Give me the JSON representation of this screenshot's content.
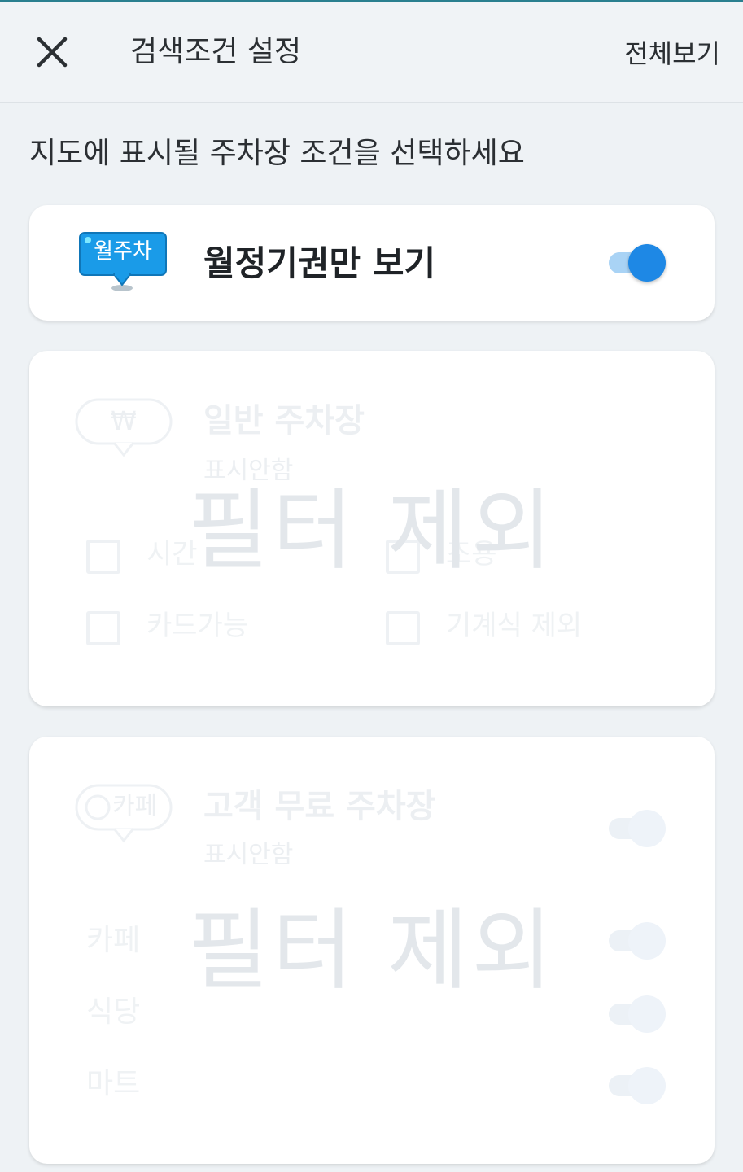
{
  "header": {
    "title": "검색조건 설정",
    "view_all_label": "전체보기"
  },
  "subtitle": "지도에 표시될 주차장 조건을 선택하세요",
  "monthly": {
    "badge_text": "월주차",
    "title": "월정기권만 보기",
    "enabled": true
  },
  "general": {
    "badge_symbol": "₩",
    "title": "일반 주차장",
    "status": "표시안함",
    "overlay": "필터 제외",
    "options": [
      "시간",
      "조용",
      "카드가능",
      "기계식 제외"
    ]
  },
  "free": {
    "badge_text": "카페",
    "title": "고객 무료 주차장",
    "status": "표시안함",
    "overlay": "필터 제외",
    "rows": [
      "카페",
      "식당",
      "마트"
    ]
  },
  "colors": {
    "accent": "#1e88e5",
    "badge_blue": "#1a9be8",
    "background": "#eef2f5"
  }
}
